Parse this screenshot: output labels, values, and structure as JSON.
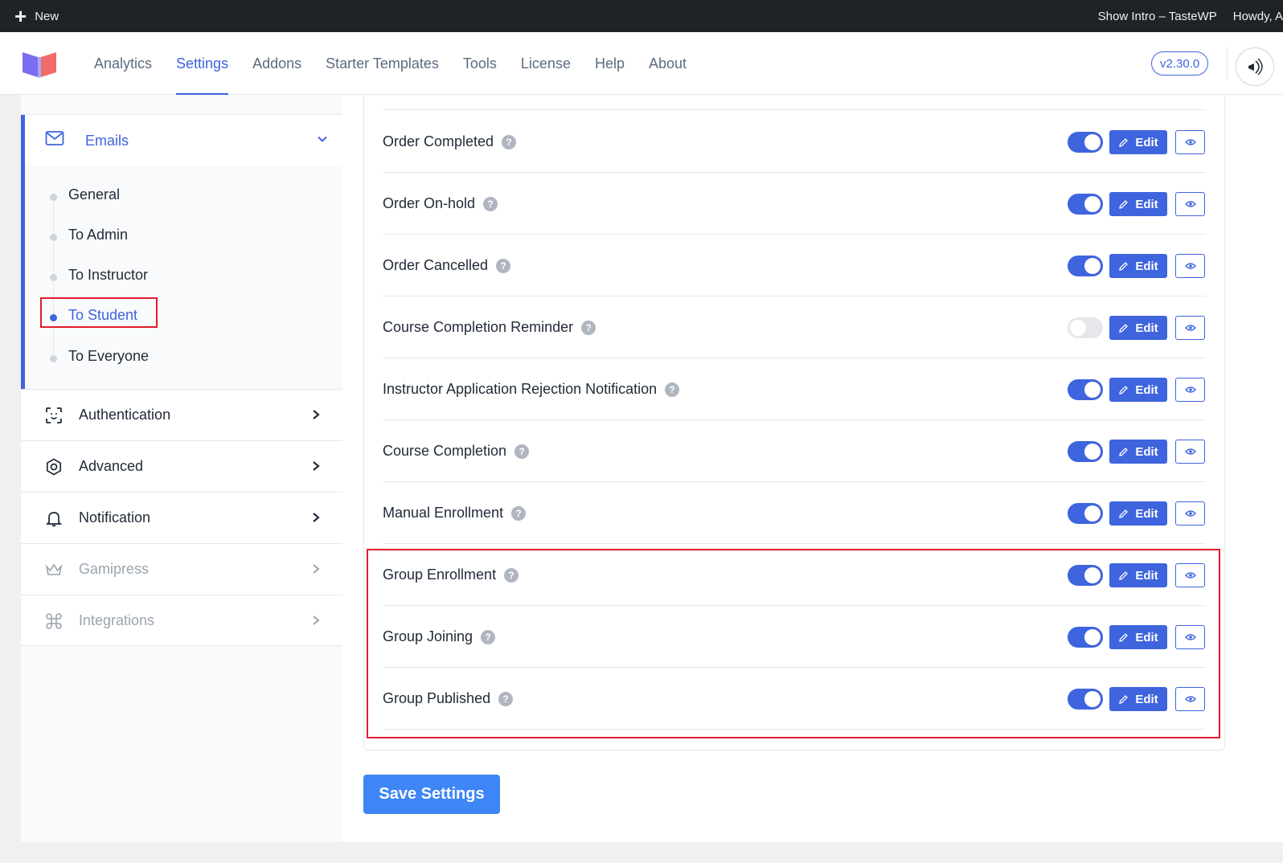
{
  "adminbar": {
    "new_label": "New",
    "show_intro": "Show Intro – TasteWP",
    "howdy": "Howdy, A"
  },
  "nav": {
    "items": [
      {
        "label": "Analytics"
      },
      {
        "label": "Settings",
        "active": true
      },
      {
        "label": "Addons"
      },
      {
        "label": "Starter Templates"
      },
      {
        "label": "Tools"
      },
      {
        "label": "License"
      },
      {
        "label": "Help"
      },
      {
        "label": "About"
      }
    ],
    "version": "v2.30.0"
  },
  "sidebar": {
    "emails_label": "Emails",
    "subitems": [
      {
        "label": "General"
      },
      {
        "label": "To Admin"
      },
      {
        "label": "To Instructor"
      },
      {
        "label": "To Student",
        "active": true
      },
      {
        "label": "To Everyone"
      }
    ],
    "sections": [
      {
        "label": "Authentication",
        "icon": "face-scan-icon"
      },
      {
        "label": "Advanced",
        "icon": "cog-icon"
      },
      {
        "label": "Notification",
        "icon": "bell-icon"
      },
      {
        "label": "Gamipress",
        "icon": "crown-icon",
        "disabled": true
      },
      {
        "label": "Integrations",
        "icon": "command-icon",
        "disabled": true
      }
    ]
  },
  "emails": [
    {
      "title": "Order Completed",
      "enabled": true
    },
    {
      "title": "Order On-hold",
      "enabled": true
    },
    {
      "title": "Order Cancelled",
      "enabled": true
    },
    {
      "title": "Course Completion Reminder",
      "enabled": false
    },
    {
      "title": "Instructor Application Rejection Notification",
      "enabled": true
    },
    {
      "title": "Course Completion",
      "enabled": true
    },
    {
      "title": "Manual Enrollment",
      "enabled": true
    },
    {
      "title": "Group Enrollment",
      "enabled": true
    },
    {
      "title": "Group Joining",
      "enabled": true
    },
    {
      "title": "Group Published",
      "enabled": true
    }
  ],
  "labels": {
    "edit": "Edit",
    "help": "?",
    "save": "Save Settings"
  },
  "colors": {
    "accent": "#3e64de",
    "highlight": "#e11d2a",
    "save": "#3e86f5"
  }
}
